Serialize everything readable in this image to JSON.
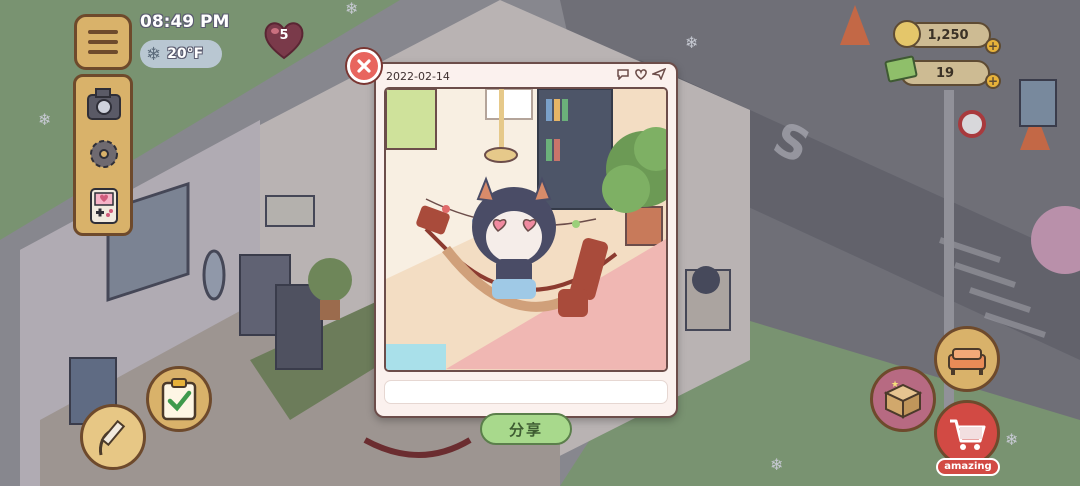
{
  "hud": {
    "time": "08:49 PM",
    "temperature": "20°F",
    "hearts": "5",
    "coins": "1,250",
    "cash": "19",
    "plus": "+",
    "amazing_label": "amazing"
  },
  "photo": {
    "date": "2022-02-14",
    "caption": ""
  },
  "buttons": {
    "share": "分享"
  }
}
